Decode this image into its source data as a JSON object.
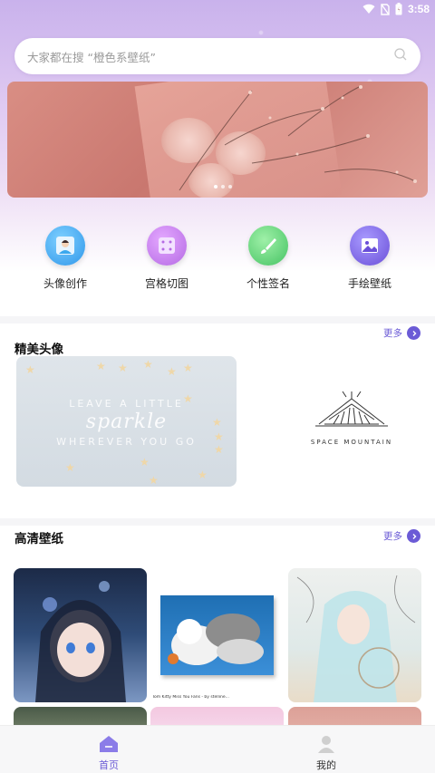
{
  "status_bar": {
    "time": "3:58"
  },
  "search": {
    "placeholder": "大家都在搜 “橙色系壁纸”"
  },
  "banner": {
    "dots": 3,
    "active_dot": 1
  },
  "quick_entries": [
    {
      "label": "头像创作",
      "icon": "avatar-create-icon",
      "color": "#3aa8ee"
    },
    {
      "label": "宫格切图",
      "icon": "grid-cut-icon",
      "color": "#c27be8"
    },
    {
      "label": "个性签名",
      "icon": "brush-signature-icon",
      "color": "#5fd07e"
    },
    {
      "label": "手绘壁纸",
      "icon": "image-wallpaper-icon",
      "color": "#7a5fe0"
    }
  ],
  "section_avatars": {
    "title": "精美头像",
    "more": "更多"
  },
  "avatar_card": {
    "line1": "LEAVE A LITTLE",
    "line2": "sparkle",
    "line3": "WHEREVER YOU GO",
    "logo_text": "SPACE MOUNTAIN"
  },
  "section_wallpapers": {
    "title": "高清壁纸",
    "more": "更多"
  },
  "wallpaper_caption": "Tom Kitty Miss You Fans - by stelline...",
  "bottom_nav": {
    "items": [
      {
        "label": "首页",
        "icon": "home-icon",
        "active": true
      },
      {
        "label": "我的",
        "icon": "profile-icon",
        "active": false
      }
    ]
  },
  "colors": {
    "accent": "#6b5bd6"
  }
}
